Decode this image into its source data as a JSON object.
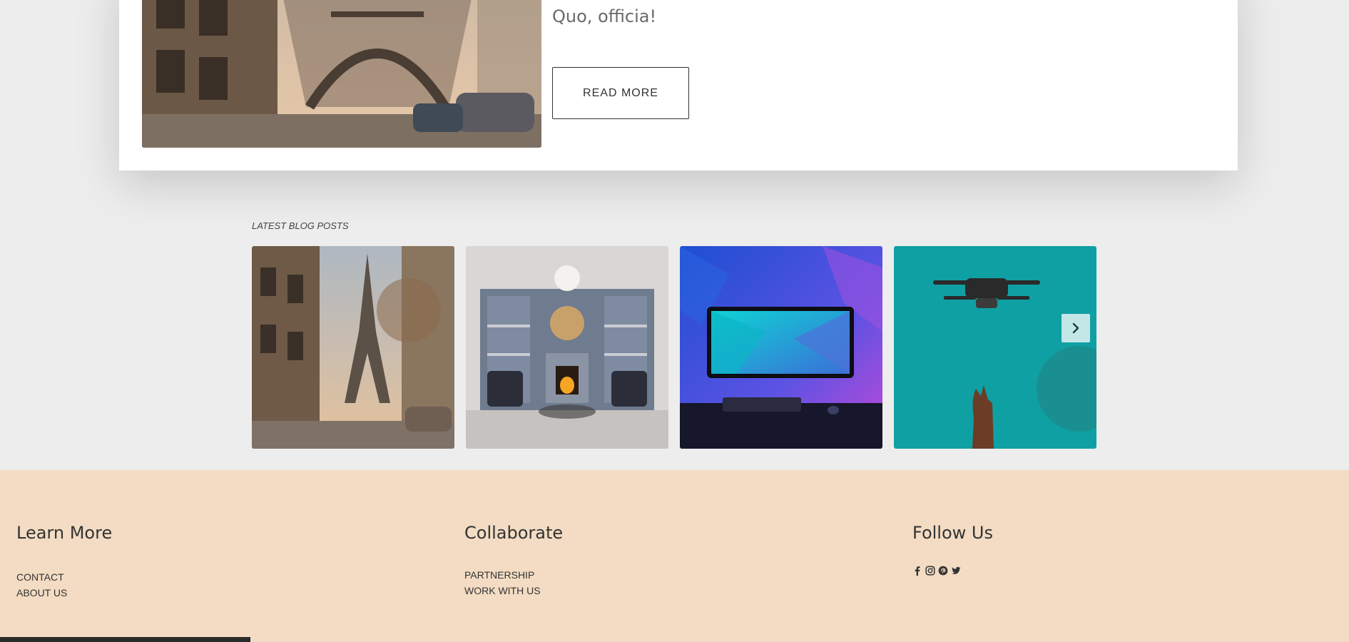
{
  "feature": {
    "text": "Quo, officia!",
    "read_more_label": "READ MORE"
  },
  "blog": {
    "heading": "LATEST BLOG POSTS",
    "posts": [
      {
        "image": "eiffel-tower-street-photo"
      },
      {
        "image": "living-room-fireplace-photo"
      },
      {
        "image": "gaming-monitor-neon-photo"
      },
      {
        "image": "drone-teal-sky-photo"
      }
    ],
    "next_icon": "chevron-right-icon"
  },
  "footer": {
    "learn_more": {
      "heading": "Learn More",
      "links": [
        "CONTACT",
        "ABOUT US"
      ]
    },
    "collaborate": {
      "heading": "Collaborate",
      "links": [
        "PARTNERSHIP",
        "WORK WITH US"
      ]
    },
    "follow_us": {
      "heading": "Follow Us",
      "icons": [
        "facebook-icon",
        "instagram-icon",
        "pinterest-icon",
        "twitter-icon"
      ]
    },
    "background_color": "#f3dcc3"
  }
}
